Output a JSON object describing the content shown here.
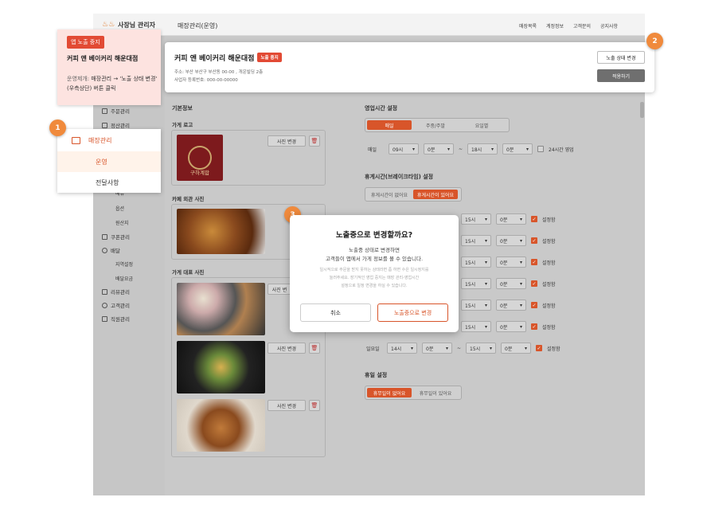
{
  "header": {
    "brand": "사장님 관리자",
    "page_title": "매장관리(운영)",
    "nav": [
      "매장목록",
      "계정정보",
      "고객문의",
      "공지사항"
    ]
  },
  "sidebar": {
    "items": [
      {
        "label": "주문관리",
        "icon": "receipt-icon"
      },
      {
        "label": "정산관리",
        "icon": "calc-icon"
      },
      {
        "label": "메뉴",
        "icon": ""
      },
      {
        "label": "옵션",
        "icon": ""
      },
      {
        "label": "원산지",
        "icon": ""
      },
      {
        "label": "쿠폰관리",
        "icon": "coupon-icon"
      },
      {
        "label": "배달",
        "icon": "bike-icon"
      },
      {
        "label": "지역설정",
        "icon": ""
      },
      {
        "label": "배달요금",
        "icon": ""
      },
      {
        "label": "리뷰관리",
        "icon": "review-icon"
      },
      {
        "label": "고객관리",
        "icon": "users-icon"
      },
      {
        "label": "직원관리",
        "icon": "staff-icon"
      }
    ]
  },
  "store_card": {
    "name": "커피 앤 베이커리 해운대점",
    "badge": "노출 중지",
    "address": "주소: 부산 부산구 부산동 00-00 , 개운빌딩 2층",
    "biz_no": "사업자 등록번호: 000-00-00000",
    "change_status_button": "노출 상태 변경",
    "apply_button": "적용하기"
  },
  "callout": {
    "badge": "앱 노출 중지",
    "store": "커피 앤 베이커리 해운대점",
    "desc_prefix": "운영제개: ",
    "desc": "매장관리 → '노출 상태 변경' (우측상단) 버튼 클릭"
  },
  "markers": [
    "1",
    "2",
    "3"
  ],
  "menu": {
    "title": "매장관리",
    "items": [
      "운영",
      "전달사항"
    ]
  },
  "basic_info": {
    "section": "기본정보",
    "logo_label": "가게 로고",
    "exterior_label": "카페 외관 사진",
    "rep_label": "가게 대표 사진",
    "change_photo": "사진 변경",
    "change_photo_partial": "사진 변",
    "logo_text": "구하계합"
  },
  "hours": {
    "section": "영업시간 설정",
    "tabs": [
      "매일",
      "주중/주말",
      "요일별"
    ],
    "row": {
      "day": "매일",
      "sh": "09시",
      "sm": "0분",
      "eh": "18시",
      "em": "0분",
      "allday": "24시간 영업"
    },
    "break_section": "휴게시간(브레이크타임) 설정",
    "break_tabs": [
      "휴게시간이 없어요",
      "휴게시간이 있어요"
    ],
    "break_rows": [
      {
        "day": "",
        "eh": "15시",
        "em": "0분",
        "label": "설정함"
      },
      {
        "day": "",
        "eh": "15시",
        "em": "0분",
        "label": "설정함"
      },
      {
        "day": "",
        "eh": "15시",
        "em": "0분",
        "label": "설정함"
      },
      {
        "day": "",
        "eh": "15시",
        "em": "0분",
        "label": "설정함"
      },
      {
        "day": "",
        "eh": "15시",
        "em": "0분",
        "label": "설정함"
      },
      {
        "day": "",
        "eh": "15시",
        "em": "0분",
        "label": "설정함"
      },
      {
        "day": "일요일",
        "sh": "14시",
        "sm": "0분",
        "eh": "15시",
        "em": "0분",
        "label": "설정함"
      }
    ],
    "holiday_section": "휴일 설정",
    "holiday_tabs": [
      "휴무일이 없어요",
      "휴무일이 있어요"
    ]
  },
  "modal": {
    "title": "노출중으로 변경할까요?",
    "line1": "노출중 상태로 변경하면",
    "line2": "고객들이 앱에서 가게 정보를 볼 수 있습니다.",
    "note1": "일시적으로 주문을 받지 못하는 상태라면 좀 하면 수은 일시정지를",
    "note2": "눌러주세요. 장기적인 영업 중지는 매장 관리-영업시간",
    "note3": "설정으로 일정 변경을 하실 수 있습니다.",
    "cancel": "취소",
    "confirm": "노출중으로 변경"
  },
  "colors": {
    "accent": "#d8552a",
    "badge": "#e24a34",
    "marker": "#f08a3c"
  }
}
